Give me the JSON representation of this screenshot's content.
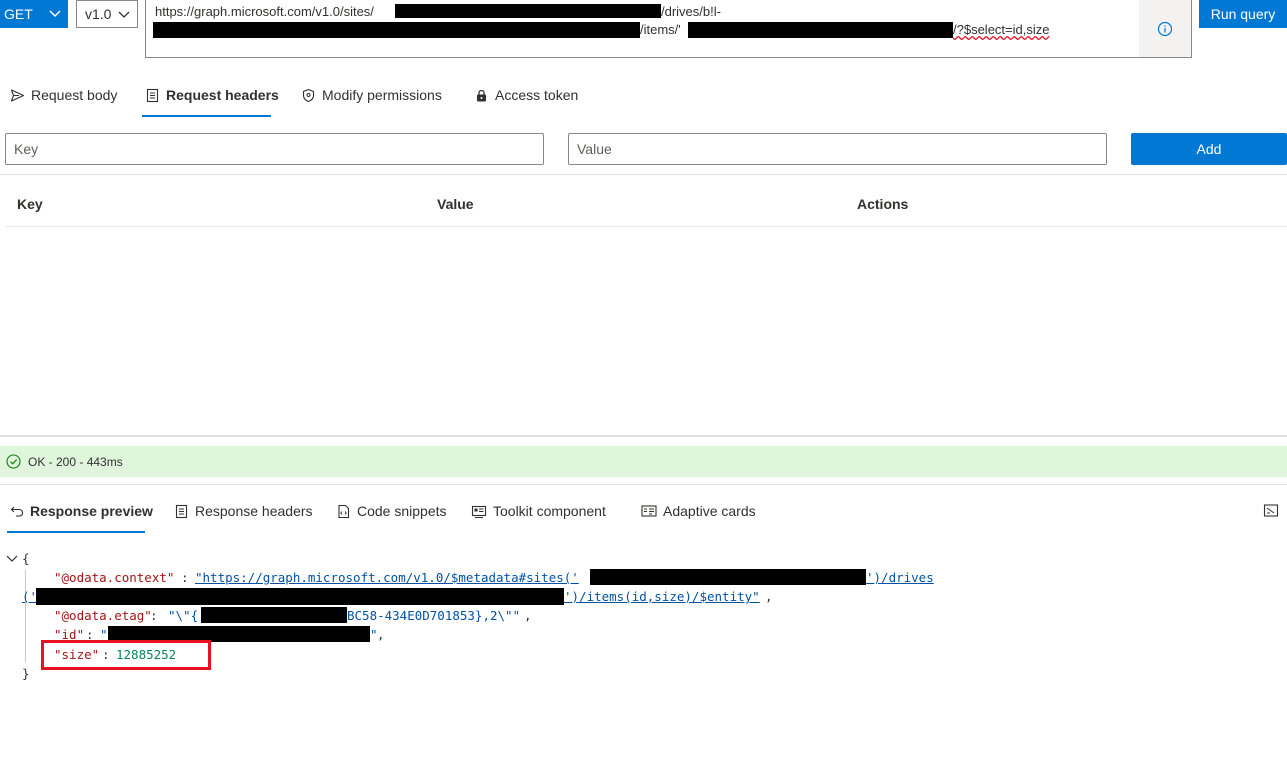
{
  "query": {
    "method": "GET",
    "version": "v1.0",
    "url_line1_prefix": "https://graph.microsoft.com/v1.0/sites/",
    "url_line1_suffix": "/drives/b!l-",
    "url_line2_mid": "/items/'",
    "url_line2_end": "/?$select=id,size",
    "run_label": "Run query"
  },
  "request_tabs": [
    {
      "label": "Request body",
      "icon": "send-icon"
    },
    {
      "label": "Request headers",
      "icon": "document-icon",
      "active": true
    },
    {
      "label": "Modify permissions",
      "icon": "shield-icon"
    },
    {
      "label": "Access token",
      "icon": "lock-icon"
    }
  ],
  "headers_form": {
    "key_placeholder": "Key",
    "value_placeholder": "Value",
    "add_label": "Add"
  },
  "headers_table": {
    "columns": [
      "Key",
      "Value",
      "Actions"
    ]
  },
  "status": {
    "text": "OK - 200 - 443ms",
    "color": "#dff6dd"
  },
  "response_tabs": [
    {
      "label": "Response preview",
      "icon": "undo-arrow-icon",
      "active": true
    },
    {
      "label": "Response headers",
      "icon": "document-icon"
    },
    {
      "label": "Code snippets",
      "icon": "code-file-icon"
    },
    {
      "label": "Toolkit component",
      "icon": "toolkit-icon"
    },
    {
      "label": "Adaptive cards",
      "icon": "card-icon"
    }
  ],
  "json_preview": {
    "open_brace": "{",
    "close_brace": "}",
    "context_key": "\"@odata.context\"",
    "context_value_start": "\"https://graph.microsoft.com/v1.0/$metadata#sites('",
    "context_value_mid": "')/drives",
    "context_value_line2_start": "('",
    "context_value_line2_end": "')/items(id,size)/$entity\"",
    "etag_key": "\"@odata.etag\"",
    "etag_value_start": "\"\\\"{",
    "etag_value_end": "BC58-434E0D701853},2\\\"\"",
    "id_key": "\"id\"",
    "id_value_start": "\"",
    "id_value_end": "\"",
    "size_key": "\"size\"",
    "size_value": "12885252"
  },
  "colors": {
    "accent": "#0078d4",
    "highlight": "#e81123"
  }
}
